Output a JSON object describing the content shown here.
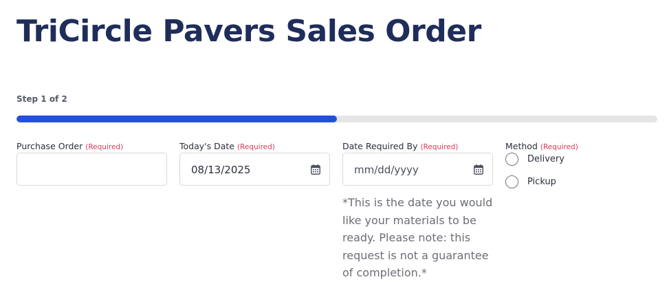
{
  "form": {
    "title": "TriCircle Pavers Sales Order",
    "step_label": "Step 1 of 2",
    "progress": 0.5
  },
  "fields": {
    "purchase_order": {
      "label": "Purchase Order",
      "required": "(Required)",
      "value": ""
    },
    "todays_date": {
      "label": "Today's Date",
      "required": "(Required)",
      "value": "08/13/2025",
      "icon": "calendar-icon"
    },
    "date_required_by": {
      "label": "Date Required By",
      "required": "(Required)",
      "placeholder": "mm/dd/yyyy",
      "icon": "calendar-icon",
      "help": "*This is the date you would like your materials to be ready. Please note: this request is not a guarantee of completion.*"
    },
    "method": {
      "label": "Method",
      "required": "(Required)",
      "options": [
        "Delivery",
        "Pickup"
      ]
    }
  },
  "colors": {
    "title": "#1f2d5a",
    "progress_fill": "#2450e0",
    "progress_track": "#e5e5e5",
    "required": "#d63a5a"
  }
}
